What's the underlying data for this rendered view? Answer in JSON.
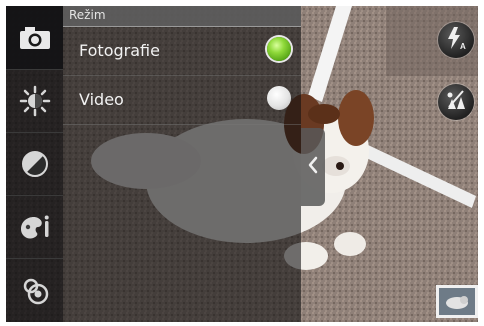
{
  "mode_panel": {
    "title": "Režim",
    "options": [
      {
        "label": "Fotografie",
        "selected": true
      },
      {
        "label": "Video",
        "selected": false
      }
    ]
  },
  "rail": {
    "icons": [
      "camera-icon",
      "brightness-icon",
      "contrast-icon",
      "color-effect-icon",
      "settings-icon"
    ]
  },
  "controls": {
    "flash_icon": "flash-auto-icon",
    "shutter_icon": "timer-icon",
    "collapse_icon": "chevron-left-icon",
    "gallery": "gallery-thumbnail"
  },
  "colors": {
    "selected_radio": "#8fd93a",
    "panel_header": "#5f5f5f"
  }
}
